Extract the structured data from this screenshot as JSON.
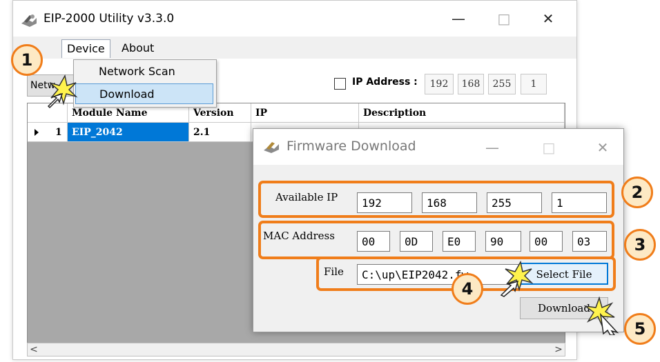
{
  "app": {
    "title": "EIP-2000 Utility v3.3.0",
    "menu": [
      "Device",
      "About"
    ],
    "device_menu": [
      "Network Scan",
      "Download"
    ],
    "net_button_label": "Netw",
    "ip_filter": {
      "label": "IP Address :",
      "octets": [
        "192",
        "168",
        "255",
        "1"
      ]
    },
    "grid": {
      "columns": [
        "Module Name",
        "Version",
        "IP",
        "Description"
      ],
      "rows": [
        {
          "index": "1",
          "module": "EIP_2042",
          "version": "2.1",
          "ip": "",
          "description": ""
        }
      ]
    },
    "scroll": {
      "left": "<",
      "right": ">"
    }
  },
  "dialog": {
    "title": "Firmware Download",
    "available_ip_label": "Available IP",
    "available_ip": [
      "192",
      "168",
      "255",
      "1"
    ],
    "mac_label": "MAC Address",
    "mac": [
      "00",
      "0D",
      "E0",
      "90",
      "00",
      "03"
    ],
    "file_label": "File",
    "file_path": "C:\\up\\EIP2042.fw",
    "select_file_label": "Select File",
    "download_label": "Download"
  },
  "callouts": [
    "1",
    "2",
    "3",
    "4",
    "5"
  ],
  "colors": {
    "highlight": "#f07d1a",
    "callout_fill": "#fde9c4",
    "selection": "#0078d7"
  },
  "icons": [
    "app-tools-icon",
    "minimize-icon",
    "maximize-icon",
    "close-icon",
    "pointer-cursor-icon"
  ]
}
